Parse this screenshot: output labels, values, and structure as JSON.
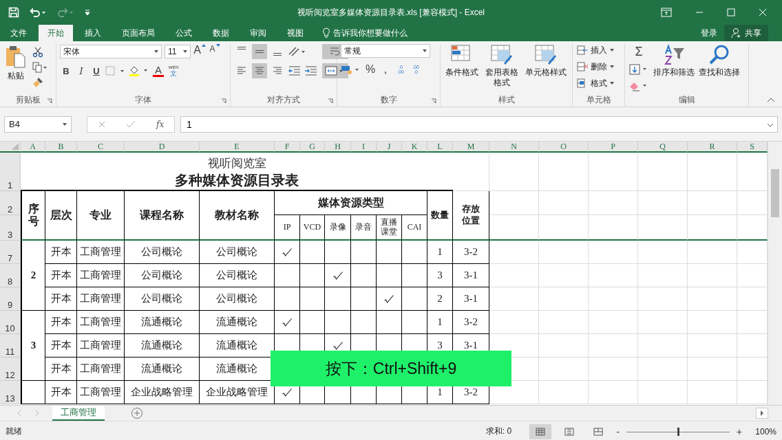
{
  "window": {
    "title": "视听阅览室多媒体资源目录表.xls  [兼容模式] - Excel"
  },
  "quick_access": [
    {
      "kind": "save",
      "disabled": false
    },
    {
      "kind": "undo",
      "disabled": false
    },
    {
      "kind": "redo",
      "disabled": true
    },
    {
      "kind": "customize",
      "disabled": false
    }
  ],
  "tabs": [
    {
      "label": "文件",
      "selected": false
    },
    {
      "label": "开始",
      "selected": true
    },
    {
      "label": "插入",
      "selected": false
    },
    {
      "label": "页面布局",
      "selected": false
    },
    {
      "label": "公式",
      "selected": false
    },
    {
      "label": "数据",
      "selected": false
    },
    {
      "label": "审阅",
      "selected": false
    },
    {
      "label": "视图",
      "selected": false
    }
  ],
  "tell_me": {
    "placeholder": "告诉我你想要做什么"
  },
  "sign_in": "登录",
  "share": "共享",
  "ribbon": {
    "clipboard": {
      "label": "剪贴板",
      "paste": "粘贴"
    },
    "font": {
      "label": "字体",
      "family": "宋体",
      "size": "11",
      "grow": "A",
      "shrink": "A",
      "bold": "B",
      "italic": "I",
      "underline": "U",
      "font_color": "A",
      "phonetic_top": "wén",
      "phonetic_bottom": "文"
    },
    "alignment": {
      "label": "对齐方式",
      "vertical": [
        {
          "selected": false
        },
        {
          "selected": true
        },
        {
          "selected": false
        }
      ],
      "horizontal": [
        {
          "selected": false
        },
        {
          "selected": true
        },
        {
          "selected": false
        }
      ],
      "wrap_on": true,
      "merge_on": true
    },
    "number": {
      "label": "数字",
      "format": "常规",
      "percent": "%",
      "comma": ",",
      "increase_decimal": [
        ".0",
        ".00"
      ],
      "decrease_decimal": [
        ".00",
        ".0"
      ]
    },
    "styles": {
      "label": "样式",
      "buttons": [
        "条件格式",
        "套用表格格式",
        "单元格样式"
      ]
    },
    "cells": {
      "label": "单元格",
      "buttons": [
        "插入",
        "删除",
        "格式"
      ]
    },
    "editing": {
      "label": "编辑",
      "sum": "Σ",
      "buttons": [
        "排序和筛选",
        "查找和选择"
      ]
    }
  },
  "formula_bar": {
    "name_box": "B4",
    "fx": "fx",
    "value": "1"
  },
  "sheet": {
    "columns": [
      "A",
      "B",
      "C",
      "D",
      "E",
      "F",
      "G",
      "H",
      "I",
      "J",
      "K",
      "L",
      "M",
      "N",
      "O",
      "P",
      "Q",
      "R",
      "S"
    ],
    "row_numbers": [
      "1",
      "2",
      "3",
      "7",
      "8",
      "9",
      "10",
      "11",
      "12",
      "13"
    ],
    "title_line1": "视听阅览室",
    "title_line2": "多种媒体资源目录表",
    "headers": {
      "seq": "序号",
      "level": "层次",
      "major": "专业",
      "course": "课程名称",
      "textbook": "教材名称",
      "media": "媒体资源类型",
      "media_types": [
        "IP",
        "VCD",
        "录像",
        "录音",
        "直播课堂",
        "CAI"
      ],
      "count": "数量",
      "location": "存放位置"
    },
    "groups": [
      {
        "seq": "2",
        "rows": [
          {
            "level": "开本",
            "major": "工商管理",
            "course": "公司概论",
            "textbook": "公司概论",
            "media": [
              true,
              false,
              false,
              false,
              false,
              false
            ],
            "count": "1",
            "location": "3-2"
          },
          {
            "level": "开本",
            "major": "工商管理",
            "course": "公司概论",
            "textbook": "公司概论",
            "media": [
              false,
              false,
              true,
              false,
              false,
              false
            ],
            "count": "3",
            "location": "3-1"
          },
          {
            "level": "开本",
            "major": "工商管理",
            "course": "公司概论",
            "textbook": "公司概论",
            "media": [
              false,
              false,
              false,
              false,
              true,
              false
            ],
            "count": "2",
            "location": "3-1"
          }
        ]
      },
      {
        "seq": "3",
        "rows": [
          {
            "level": "开本",
            "major": "工商管理",
            "course": "流通概论",
            "textbook": "流通概论",
            "media": [
              true,
              false,
              false,
              false,
              false,
              false
            ],
            "count": "1",
            "location": "3-2"
          },
          {
            "level": "开本",
            "major": "工商管理",
            "course": "流通概论",
            "textbook": "流通概论",
            "media": [
              false,
              false,
              true,
              false,
              false,
              false
            ],
            "count": "3",
            "location": "3-1"
          },
          {
            "level": "开本",
            "major": "工商管理",
            "course": "流通概论",
            "textbook": "流通概论"
          }
        ]
      },
      {
        "rows": [
          {
            "level": "开本",
            "major": "工商管理",
            "course": "企业战略管理",
            "textbook": "企业战略管理",
            "media": [
              true,
              false,
              false,
              false,
              false,
              false
            ],
            "count": "1",
            "location": "3-2"
          }
        ]
      }
    ]
  },
  "sheet_tabs": [
    {
      "label": "工商管理",
      "selected": true
    }
  ],
  "status_bar": {
    "ready": "就绪",
    "sum": "求和: 0",
    "views": [
      {
        "selected": true
      },
      {
        "selected": false
      },
      {
        "selected": false
      }
    ],
    "zoom_out": "-",
    "zoom_in": "+",
    "zoom": {
      "level": 0.5
    },
    "zoom_percent": "100%"
  },
  "hint": "按下：Ctrl+Shift+9"
}
